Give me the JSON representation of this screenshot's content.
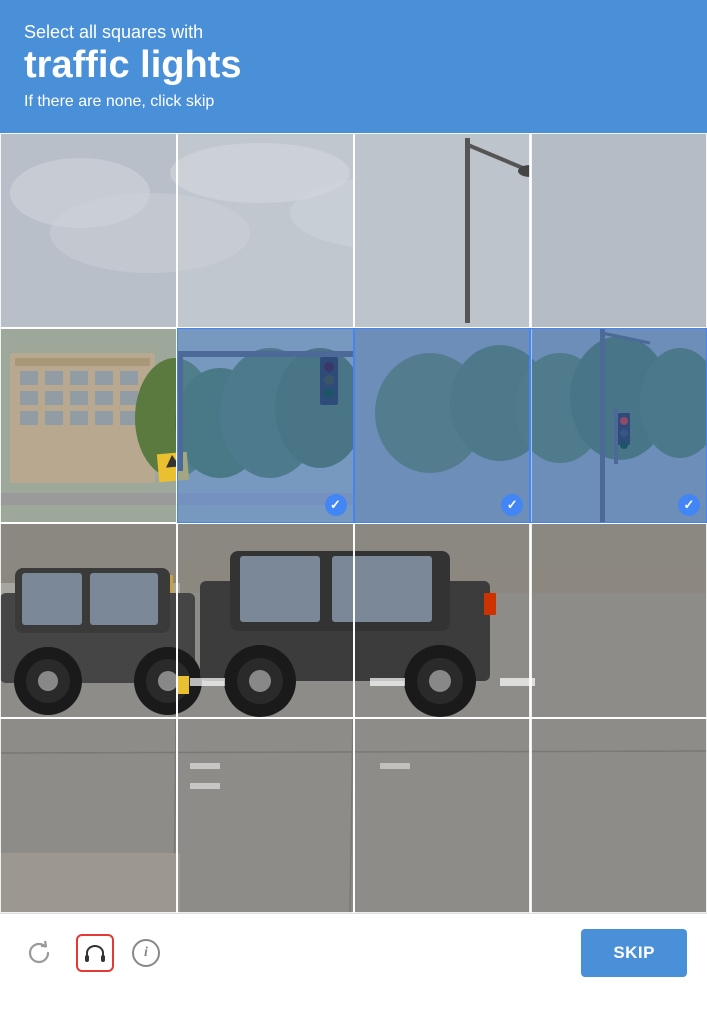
{
  "header": {
    "subtitle": "Select all squares with",
    "title": "traffic lights",
    "hint": "If there are none, click skip"
  },
  "grid": {
    "cols": 4,
    "rows": 4,
    "selected_cells": [
      5,
      6,
      7
    ]
  },
  "footer": {
    "skip_label": "SKIP",
    "refresh_title": "Refresh",
    "headphone_title": "Audio challenge",
    "info_title": "Help"
  },
  "colors": {
    "header_bg": "#4a90d9",
    "skip_btn": "#4a90d9",
    "selected_overlay": "rgba(66,133,244,0.42)",
    "grid_border": "rgba(255,255,255,0.85)"
  }
}
